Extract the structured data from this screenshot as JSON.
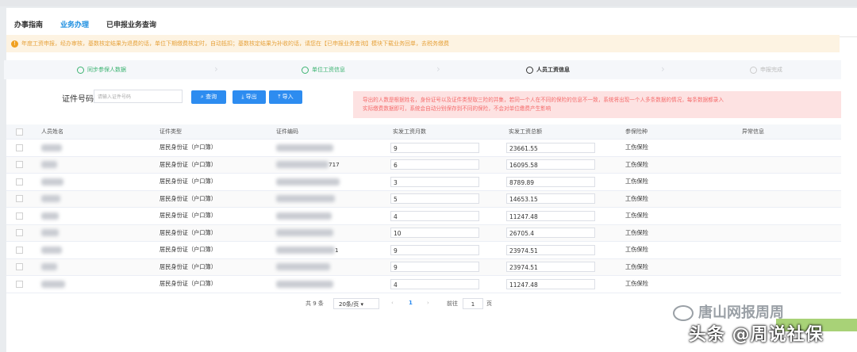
{
  "tabs": [
    {
      "label": "办事指南"
    },
    {
      "label": "业务办理",
      "active": true
    },
    {
      "label": "已申报业务查询"
    }
  ],
  "alert": {
    "text": "年度工资申报，经办审核，基数核定结果为退费的话，单位下期缴费核定时，自动抵扣；基数核定结果为补收的话，请您在【已申报业务查询】模块下载业务回单，去税务缴费"
  },
  "steps": [
    {
      "label": "同步参保人数据",
      "state": "done"
    },
    {
      "label": "单位工资信息",
      "state": "done"
    },
    {
      "label": "人员工资信息",
      "state": "current"
    },
    {
      "label": "申报完成",
      "state": "pending"
    }
  ],
  "filter": {
    "label": "证件号码",
    "placeholder": "请输入证件号码",
    "query_btn": "查询",
    "export_btn": "导出",
    "import_btn": "导入"
  },
  "warning": {
    "line1": "导出的人数是根据姓名，身份证号以及证件类型取三险的并集，若同一个人在不同的保险的信息不一致，系统将出现一个人多条数据的情况，每条数据都录入",
    "line2": "实际缴费数据即可，系统会自动分别保存到不同的保险，不会对单位缴费产生影响"
  },
  "table": {
    "headers": [
      "人员姓名",
      "证件类型",
      "证件编码",
      "实发工资月数",
      "实发工资总额",
      "参保险种",
      "异常信息"
    ],
    "rows": [
      {
        "idtype": "居民身份证（户口簿）",
        "idsuffix": "",
        "months": "9",
        "total": "23661.55",
        "insurance": "工伤保险"
      },
      {
        "idtype": "居民身份证（户口簿）",
        "idsuffix": "717",
        "months": "6",
        "total": "16095.58",
        "insurance": "工伤保险"
      },
      {
        "idtype": "居民身份证（户口簿）",
        "idsuffix": "",
        "months": "3",
        "total": "8789.89",
        "insurance": "工伤保险"
      },
      {
        "idtype": "居民身份证（户口簿）",
        "idsuffix": "",
        "months": "5",
        "total": "14653.15",
        "insurance": "工伤保险"
      },
      {
        "idtype": "居民身份证（户口簿）",
        "idsuffix": "",
        "months": "4",
        "total": "11247.48",
        "insurance": "工伤保险"
      },
      {
        "idtype": "居民身份证（户口簿）",
        "idsuffix": "",
        "months": "10",
        "total": "26705.4",
        "insurance": "工伤保险"
      },
      {
        "idtype": "居民身份证（户口簿）",
        "idsuffix": "1",
        "months": "9",
        "total": "23974.51",
        "insurance": "工伤保险"
      },
      {
        "idtype": "居民身份证（户口簿）",
        "idsuffix": "",
        "months": "9",
        "total": "23974.51",
        "insurance": "工伤保险"
      },
      {
        "idtype": "居民身份证（户口簿）",
        "idsuffix": "",
        "months": "4",
        "total": "11247.48",
        "insurance": "工伤保险"
      }
    ]
  },
  "pager": {
    "total": "共 9 条",
    "pagesize": "20条/页",
    "prev": "‹",
    "current": "1",
    "next": "›",
    "goto_label": "前往",
    "goto_value": "1",
    "page_unit": "页"
  },
  "watermark": {
    "line1": "唐山网报周周",
    "line2": "头条 @周说社保"
  }
}
